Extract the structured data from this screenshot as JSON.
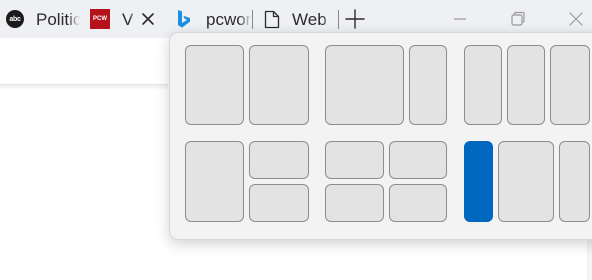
{
  "tabs": [
    {
      "label": "Politico",
      "favicon": "abc-news-favicon",
      "favicon_text": "abc"
    },
    {
      "label": "V",
      "favicon": "pcworld-favicon",
      "favicon_text": "PCW",
      "close": "close-icon"
    },
    {
      "label": "pcworld",
      "favicon": "bing-favicon"
    },
    {
      "label": "Web",
      "favicon": "document-icon"
    }
  ],
  "new_tab_icon": "plus-icon",
  "window_controls": [
    "minimize-icon",
    "restore-icon",
    "close-icon"
  ],
  "snap_layouts": {
    "selected_group": 5,
    "selected_zone": 0,
    "accent_color": "#0067c0"
  }
}
